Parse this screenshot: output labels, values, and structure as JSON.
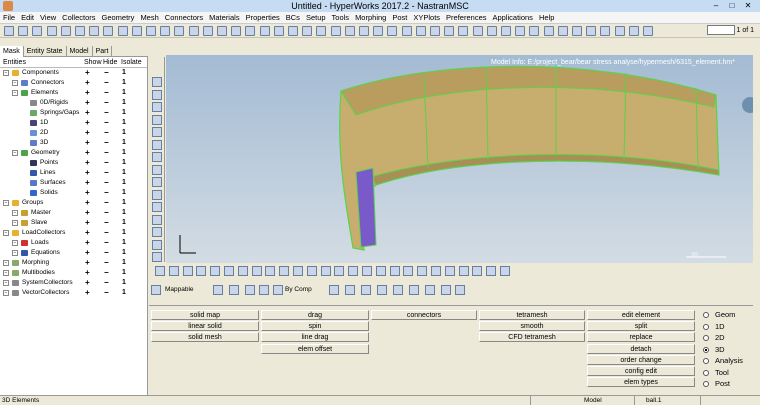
{
  "title": "Untitled - HyperWorks 2017.2 - NastranMSC",
  "menu": [
    "File",
    "Edit",
    "View",
    "Collectors",
    "Geometry",
    "Mesh",
    "Connectors",
    "Materials",
    "Properties",
    "BCs",
    "Setup",
    "Tools",
    "Morphing",
    "Post",
    "XYPlots",
    "Preferences",
    "Applications",
    "Help"
  ],
  "page_indicator": "1 of 1",
  "tabs": [
    "Mask",
    "Entity State",
    "Model",
    "Part"
  ],
  "tree_header": {
    "entities": "Entities",
    "show": "Show",
    "hide": "Hide",
    "isolate": "Isolate"
  },
  "tree": [
    {
      "label": "Components",
      "level": 0,
      "icon": "components-icon"
    },
    {
      "label": "Connectors",
      "level": 1,
      "icon": "connectors-icon"
    },
    {
      "label": "Elements",
      "level": 1,
      "icon": "elements-icon"
    },
    {
      "label": "0D/Rigids",
      "level": 2,
      "icon": "rigid-icon"
    },
    {
      "label": "Springs/Gaps",
      "level": 2,
      "icon": "spring-icon"
    },
    {
      "label": "1D",
      "level": 2,
      "icon": "element-1d-icon"
    },
    {
      "label": "2D",
      "level": 2,
      "icon": "element-2d-icon"
    },
    {
      "label": "3D",
      "level": 2,
      "icon": "element-3d-icon"
    },
    {
      "label": "Geometry",
      "level": 1,
      "icon": "geometry-icon"
    },
    {
      "label": "Points",
      "level": 2,
      "icon": "points-icon"
    },
    {
      "label": "Lines",
      "level": 2,
      "icon": "lines-icon"
    },
    {
      "label": "Surfaces",
      "level": 2,
      "icon": "surfaces-icon"
    },
    {
      "label": "Solids",
      "level": 2,
      "icon": "solids-icon"
    },
    {
      "label": "Groups",
      "level": 0,
      "icon": "groups-icon"
    },
    {
      "label": "Master",
      "level": 1,
      "icon": "master-icon"
    },
    {
      "label": "Slave",
      "level": 1,
      "icon": "slave-icon"
    },
    {
      "label": "LoadCollectors",
      "level": 0,
      "icon": "loadcollectors-icon"
    },
    {
      "label": "Loads",
      "level": 1,
      "icon": "loads-icon"
    },
    {
      "label": "Equations",
      "level": 1,
      "icon": "equations-icon"
    },
    {
      "label": "Morphing",
      "level": 0,
      "icon": "morphing-icon"
    },
    {
      "label": "Multibodies",
      "level": 0,
      "icon": "multibodies-icon"
    },
    {
      "label": "SystemCollectors",
      "level": 0,
      "icon": "systemcollectors-icon"
    },
    {
      "label": "VectorCollectors",
      "level": 0,
      "icon": "vectorcollectors-icon"
    }
  ],
  "tree_marks": {
    "plus": "+",
    "minus": "−",
    "one": "1"
  },
  "viewport": {
    "model_info": "Model Info: E:/project_bear/bear stress analyse/hypermesh/6315_element.hm*",
    "scale": "20"
  },
  "toolbar": {
    "mappable": "Mappable",
    "by_comp": "By Comp"
  },
  "panel": {
    "col1": [
      "solid map",
      "linear solid",
      "solid mesh"
    ],
    "col2": [
      "drag",
      "spin",
      "line drag",
      "elem offset"
    ],
    "col3": [
      "connectors"
    ],
    "col4": [
      "tetramesh",
      "smooth",
      "CFD tetramesh"
    ],
    "col5": [
      "edit element",
      "split",
      "replace",
      "detach",
      "order change",
      "config edit",
      "elem types"
    ]
  },
  "radios": [
    {
      "label": "Geom",
      "on": false
    },
    {
      "label": "1D",
      "on": false
    },
    {
      "label": "2D",
      "on": false
    },
    {
      "label": "3D",
      "on": true
    },
    {
      "label": "Analysis",
      "on": false
    },
    {
      "label": "Tool",
      "on": false
    },
    {
      "label": "Post",
      "on": false
    }
  ],
  "status": {
    "left": "3D Elements",
    "model": "Model",
    "comp": "ball.1"
  },
  "colors": {
    "part_fill": "#c7ad6e",
    "mesh_edge": "#5ad34a",
    "selected_elem": "#7a5ac8"
  }
}
